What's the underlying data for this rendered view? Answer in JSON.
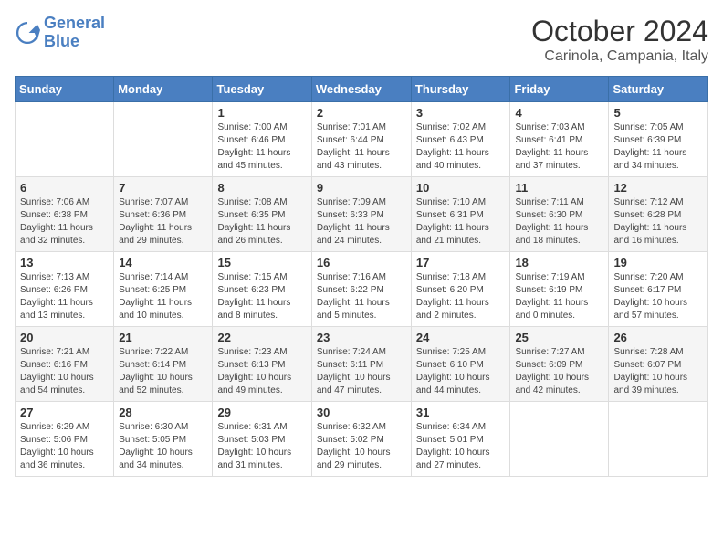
{
  "header": {
    "logo_line1": "General",
    "logo_line2": "Blue",
    "month": "October 2024",
    "location": "Carinola, Campania, Italy"
  },
  "weekdays": [
    "Sunday",
    "Monday",
    "Tuesday",
    "Wednesday",
    "Thursday",
    "Friday",
    "Saturday"
  ],
  "weeks": [
    [
      {
        "day": "",
        "sunrise": "",
        "sunset": "",
        "daylight": ""
      },
      {
        "day": "",
        "sunrise": "",
        "sunset": "",
        "daylight": ""
      },
      {
        "day": "1",
        "sunrise": "Sunrise: 7:00 AM",
        "sunset": "Sunset: 6:46 PM",
        "daylight": "Daylight: 11 hours and 45 minutes."
      },
      {
        "day": "2",
        "sunrise": "Sunrise: 7:01 AM",
        "sunset": "Sunset: 6:44 PM",
        "daylight": "Daylight: 11 hours and 43 minutes."
      },
      {
        "day": "3",
        "sunrise": "Sunrise: 7:02 AM",
        "sunset": "Sunset: 6:43 PM",
        "daylight": "Daylight: 11 hours and 40 minutes."
      },
      {
        "day": "4",
        "sunrise": "Sunrise: 7:03 AM",
        "sunset": "Sunset: 6:41 PM",
        "daylight": "Daylight: 11 hours and 37 minutes."
      },
      {
        "day": "5",
        "sunrise": "Sunrise: 7:05 AM",
        "sunset": "Sunset: 6:39 PM",
        "daylight": "Daylight: 11 hours and 34 minutes."
      }
    ],
    [
      {
        "day": "6",
        "sunrise": "Sunrise: 7:06 AM",
        "sunset": "Sunset: 6:38 PM",
        "daylight": "Daylight: 11 hours and 32 minutes."
      },
      {
        "day": "7",
        "sunrise": "Sunrise: 7:07 AM",
        "sunset": "Sunset: 6:36 PM",
        "daylight": "Daylight: 11 hours and 29 minutes."
      },
      {
        "day": "8",
        "sunrise": "Sunrise: 7:08 AM",
        "sunset": "Sunset: 6:35 PM",
        "daylight": "Daylight: 11 hours and 26 minutes."
      },
      {
        "day": "9",
        "sunrise": "Sunrise: 7:09 AM",
        "sunset": "Sunset: 6:33 PM",
        "daylight": "Daylight: 11 hours and 24 minutes."
      },
      {
        "day": "10",
        "sunrise": "Sunrise: 7:10 AM",
        "sunset": "Sunset: 6:31 PM",
        "daylight": "Daylight: 11 hours and 21 minutes."
      },
      {
        "day": "11",
        "sunrise": "Sunrise: 7:11 AM",
        "sunset": "Sunset: 6:30 PM",
        "daylight": "Daylight: 11 hours and 18 minutes."
      },
      {
        "day": "12",
        "sunrise": "Sunrise: 7:12 AM",
        "sunset": "Sunset: 6:28 PM",
        "daylight": "Daylight: 11 hours and 16 minutes."
      }
    ],
    [
      {
        "day": "13",
        "sunrise": "Sunrise: 7:13 AM",
        "sunset": "Sunset: 6:26 PM",
        "daylight": "Daylight: 11 hours and 13 minutes."
      },
      {
        "day": "14",
        "sunrise": "Sunrise: 7:14 AM",
        "sunset": "Sunset: 6:25 PM",
        "daylight": "Daylight: 11 hours and 10 minutes."
      },
      {
        "day": "15",
        "sunrise": "Sunrise: 7:15 AM",
        "sunset": "Sunset: 6:23 PM",
        "daylight": "Daylight: 11 hours and 8 minutes."
      },
      {
        "day": "16",
        "sunrise": "Sunrise: 7:16 AM",
        "sunset": "Sunset: 6:22 PM",
        "daylight": "Daylight: 11 hours and 5 minutes."
      },
      {
        "day": "17",
        "sunrise": "Sunrise: 7:18 AM",
        "sunset": "Sunset: 6:20 PM",
        "daylight": "Daylight: 11 hours and 2 minutes."
      },
      {
        "day": "18",
        "sunrise": "Sunrise: 7:19 AM",
        "sunset": "Sunset: 6:19 PM",
        "daylight": "Daylight: 11 hours and 0 minutes."
      },
      {
        "day": "19",
        "sunrise": "Sunrise: 7:20 AM",
        "sunset": "Sunset: 6:17 PM",
        "daylight": "Daylight: 10 hours and 57 minutes."
      }
    ],
    [
      {
        "day": "20",
        "sunrise": "Sunrise: 7:21 AM",
        "sunset": "Sunset: 6:16 PM",
        "daylight": "Daylight: 10 hours and 54 minutes."
      },
      {
        "day": "21",
        "sunrise": "Sunrise: 7:22 AM",
        "sunset": "Sunset: 6:14 PM",
        "daylight": "Daylight: 10 hours and 52 minutes."
      },
      {
        "day": "22",
        "sunrise": "Sunrise: 7:23 AM",
        "sunset": "Sunset: 6:13 PM",
        "daylight": "Daylight: 10 hours and 49 minutes."
      },
      {
        "day": "23",
        "sunrise": "Sunrise: 7:24 AM",
        "sunset": "Sunset: 6:11 PM",
        "daylight": "Daylight: 10 hours and 47 minutes."
      },
      {
        "day": "24",
        "sunrise": "Sunrise: 7:25 AM",
        "sunset": "Sunset: 6:10 PM",
        "daylight": "Daylight: 10 hours and 44 minutes."
      },
      {
        "day": "25",
        "sunrise": "Sunrise: 7:27 AM",
        "sunset": "Sunset: 6:09 PM",
        "daylight": "Daylight: 10 hours and 42 minutes."
      },
      {
        "day": "26",
        "sunrise": "Sunrise: 7:28 AM",
        "sunset": "Sunset: 6:07 PM",
        "daylight": "Daylight: 10 hours and 39 minutes."
      }
    ],
    [
      {
        "day": "27",
        "sunrise": "Sunrise: 6:29 AM",
        "sunset": "Sunset: 5:06 PM",
        "daylight": "Daylight: 10 hours and 36 minutes."
      },
      {
        "day": "28",
        "sunrise": "Sunrise: 6:30 AM",
        "sunset": "Sunset: 5:05 PM",
        "daylight": "Daylight: 10 hours and 34 minutes."
      },
      {
        "day": "29",
        "sunrise": "Sunrise: 6:31 AM",
        "sunset": "Sunset: 5:03 PM",
        "daylight": "Daylight: 10 hours and 31 minutes."
      },
      {
        "day": "30",
        "sunrise": "Sunrise: 6:32 AM",
        "sunset": "Sunset: 5:02 PM",
        "daylight": "Daylight: 10 hours and 29 minutes."
      },
      {
        "day": "31",
        "sunrise": "Sunrise: 6:34 AM",
        "sunset": "Sunset: 5:01 PM",
        "daylight": "Daylight: 10 hours and 27 minutes."
      },
      {
        "day": "",
        "sunrise": "",
        "sunset": "",
        "daylight": ""
      },
      {
        "day": "",
        "sunrise": "",
        "sunset": "",
        "daylight": ""
      }
    ]
  ]
}
